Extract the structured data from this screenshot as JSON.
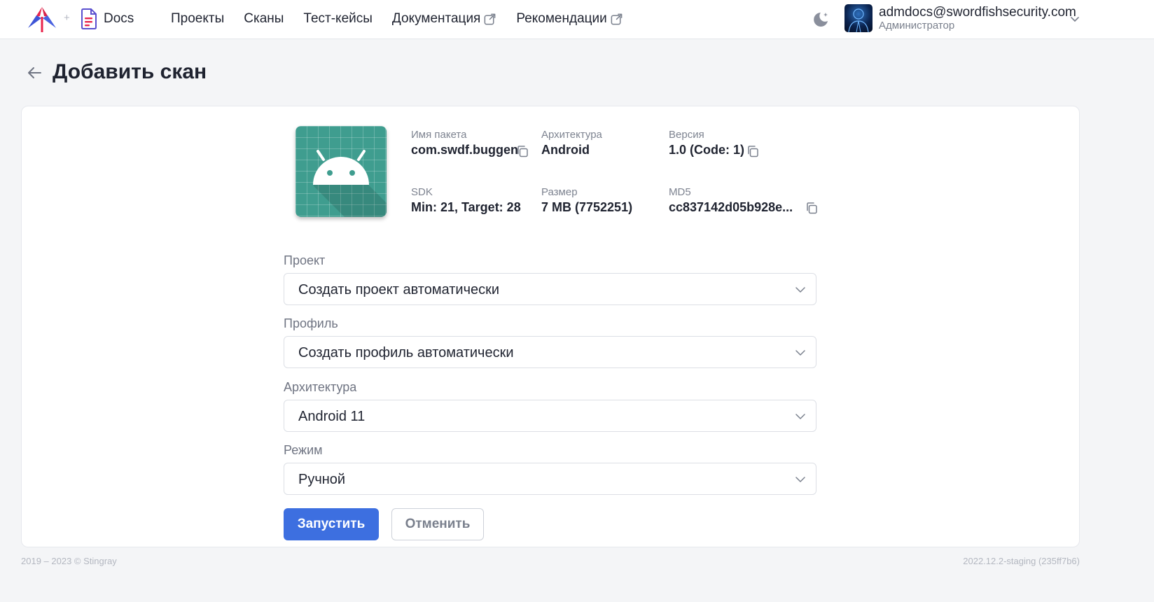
{
  "header": {
    "plus": "+",
    "docs_label": "Docs",
    "nav": [
      {
        "label": "Проекты",
        "external": false
      },
      {
        "label": "Сканы",
        "external": false
      },
      {
        "label": "Тест-кейсы",
        "external": false
      },
      {
        "label": "Документация",
        "external": true
      },
      {
        "label": "Рекомендации",
        "external": true
      }
    ],
    "user": {
      "email": "admdocs@swordfishsecurity.com",
      "role": "Администратор"
    }
  },
  "page": {
    "title": "Добавить скан"
  },
  "app_info": {
    "package_label": "Имя пакета",
    "package_value": "com.swdf.buggen",
    "arch_label": "Архитектура",
    "arch_value": "Android",
    "version_label": "Версия",
    "version_value": "1.0 (Code: 1)",
    "sdk_label": "SDK",
    "sdk_value": "Min: 21, Target: 28",
    "size_label": "Размер",
    "size_value": "7 MB (7752251)",
    "md5_label": "MD5",
    "md5_value": "cc837142d05b928e..."
  },
  "form": {
    "project_label": "Проект",
    "project_value": "Создать проект автоматически",
    "profile_label": "Профиль",
    "profile_value": "Создать профиль автоматически",
    "arch_label": "Архитектура",
    "arch_value": "Android 11",
    "mode_label": "Режим",
    "mode_value": "Ручной",
    "submit_label": "Запустить",
    "cancel_label": "Отменить"
  },
  "footer": {
    "copyright": "2019 – 2023 © Stingray",
    "build": "2022.12.2-staging (235ff7b6)"
  },
  "colors": {
    "primary": "#3d6fe0",
    "app_icon_bg": "#3f9d8f",
    "logo_red": "#e8244c",
    "logo_blue": "#3d54d6"
  }
}
